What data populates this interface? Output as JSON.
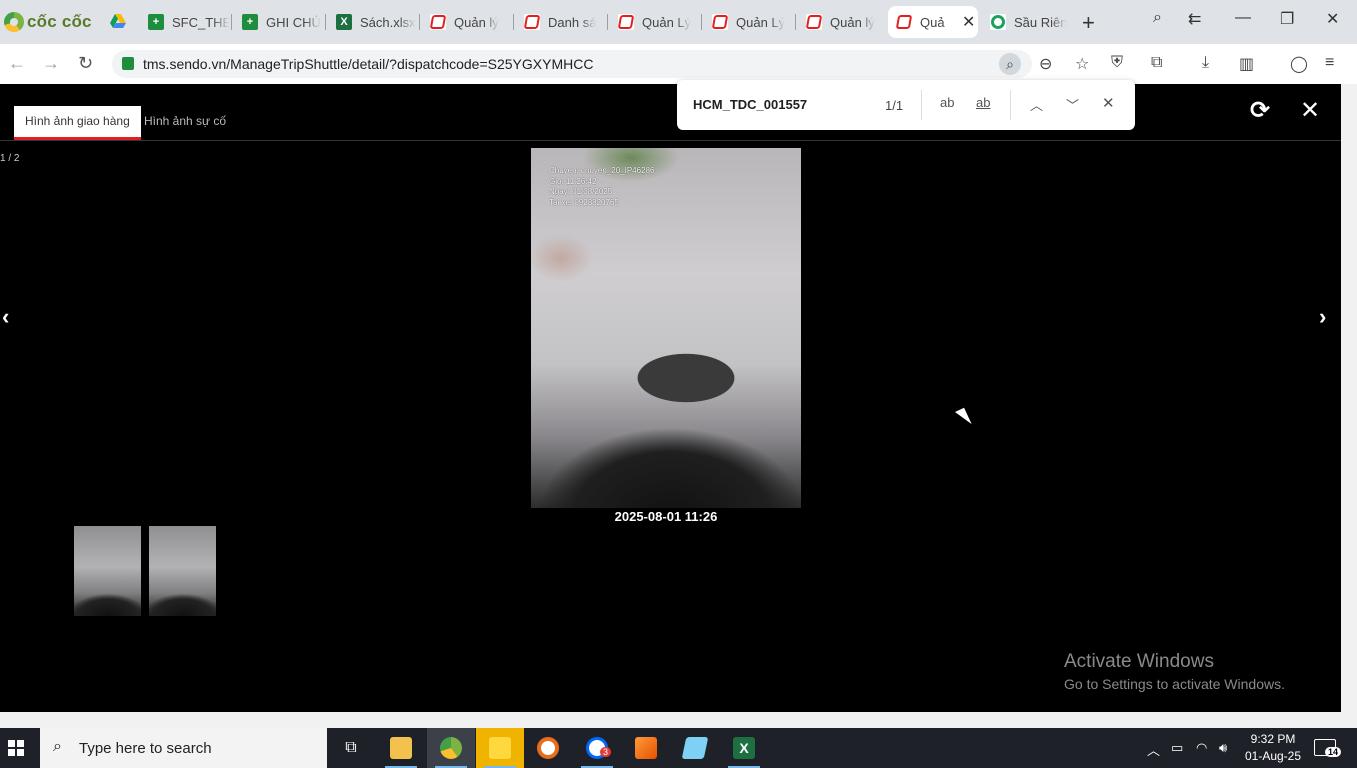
{
  "browser": {
    "brand": "cốc cốc",
    "tabs": [
      {
        "label": "SFC_THE",
        "icon": "sheets-icon"
      },
      {
        "label": "GHI CHÚ",
        "icon": "sheets-icon"
      },
      {
        "label": "Sách.xlsx",
        "icon": "excel-icon"
      },
      {
        "label": "Quản lý",
        "icon": "sendo-icon"
      },
      {
        "label": "Danh sá",
        "icon": "sendo-icon"
      },
      {
        "label": "Quản Lý",
        "icon": "sendo-icon"
      },
      {
        "label": "Quản Lý",
        "icon": "sendo-icon"
      },
      {
        "label": "Quản lý",
        "icon": "sendo-icon"
      },
      {
        "label": "Quả",
        "icon": "sendo-icon",
        "active": true
      },
      {
        "label": "Sầu Riên",
        "icon": "green-s-icon"
      }
    ],
    "url": "tms.sendo.vn/ManageTripShuttle/detail/?dispatchcode=S25YGXYMHCC"
  },
  "find_bar": {
    "query": "HCM_TDC_001557",
    "count": "1/1",
    "match_case_label": "ab",
    "whole_word_label": "ab"
  },
  "viewer": {
    "tabs": [
      "Hình ảnh giao hàng",
      "Hình ảnh sự cố"
    ],
    "counter": "1 / 2",
    "stamp_lines": [
      "Chuyen: chuyen_20_IP46286",
      "Gio: 11:26:42",
      "Ngay: 01/08/2025",
      "Tai xe: 0923820765"
    ],
    "caption": "2025-08-01 11:26"
  },
  "watermark": {
    "title": "Activate Windows",
    "subtitle": "Go to Settings to activate Windows."
  },
  "taskbar": {
    "search_placeholder": "Type here to search",
    "time": "9:32 PM",
    "date": "01-Aug-25",
    "notification_count": "14",
    "zalo_badge": "3"
  }
}
